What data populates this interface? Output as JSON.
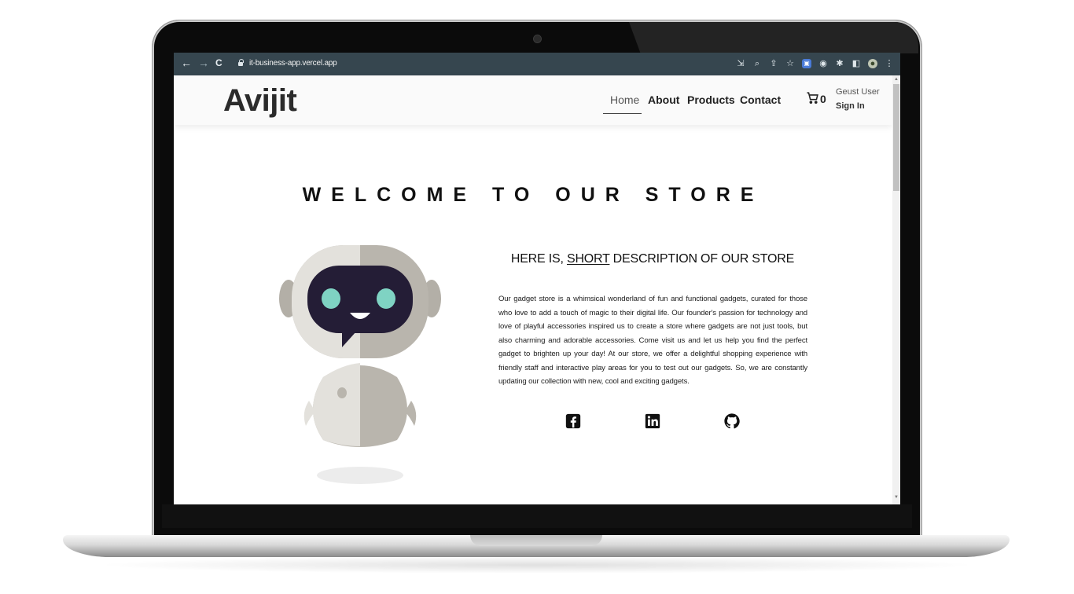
{
  "browser": {
    "url": "it-business-app.vercel.app",
    "nav": {
      "back": "←",
      "forward": "→",
      "reload": "C"
    }
  },
  "site": {
    "logo": "Avijit",
    "nav": [
      {
        "label": "Home",
        "active": true
      },
      {
        "label": "About"
      },
      {
        "label": "Products"
      },
      {
        "label": "Contact"
      }
    ],
    "cart_count": "0",
    "user": {
      "name": "Geust User",
      "action": "Sign In"
    }
  },
  "hero": {
    "title": "WELCOME TO OUR STORE",
    "subhead_before": "HERE IS, ",
    "subhead_underlined": "SHORT",
    "subhead_after": " DESCRIPTION OF OUR STORE",
    "description": "Our gadget store is a whimsical wonderland of fun and functional gadgets, curated for those who love to add a touch of magic to their digital life. Our founder's passion for technology and love of playful accessories inspired us to create a store where gadgets are not just tools, but also charming and adorable accessories. Come visit us and let us help you find the perfect gadget to brighten up your day! At our store, we offer a delightful shopping experience with friendly staff and interactive play areas for you to test out our gadgets. So, we are constantly updating our collection with new, cool and exciting gadgets.",
    "social": [
      {
        "icon": "facebook-icon"
      },
      {
        "icon": "linkedin-icon"
      },
      {
        "icon": "github-icon"
      }
    ]
  },
  "colors": {
    "browser_bar": "#36464f",
    "header_bg": "#fafafa",
    "robot_face": "#241d36",
    "robot_eye": "#7fd3c3"
  }
}
